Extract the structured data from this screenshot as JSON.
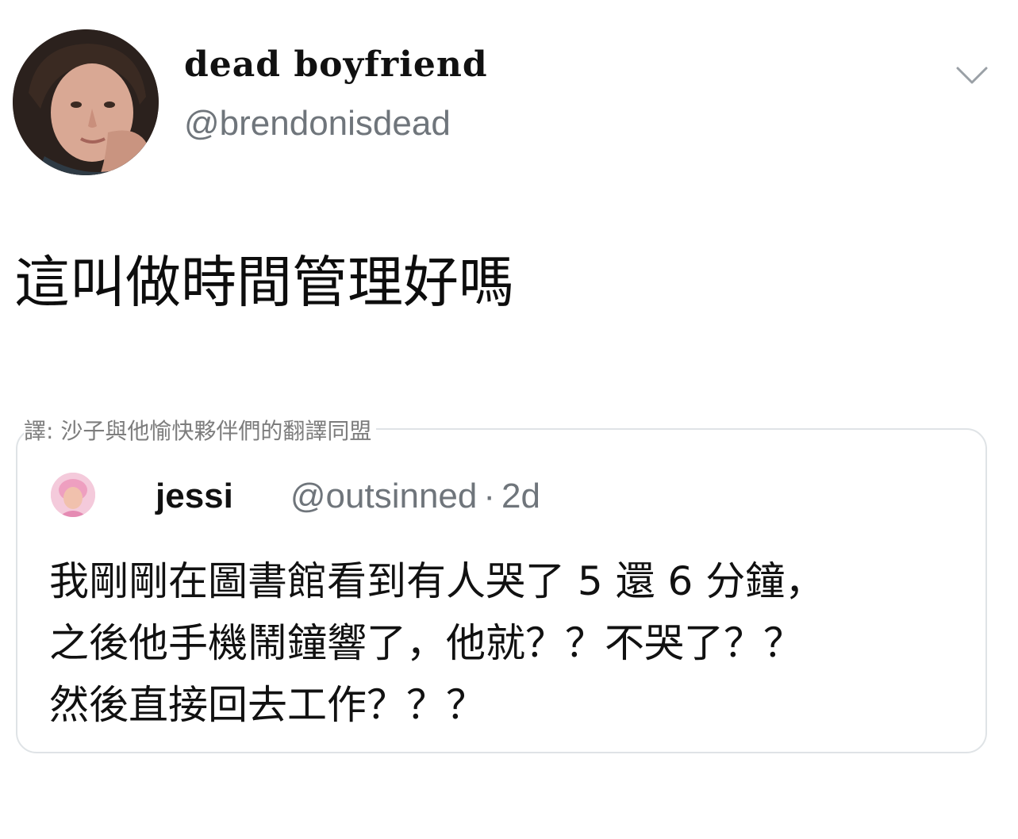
{
  "header": {
    "display_name": "dead boyfriend",
    "handle": "@brendonisdead",
    "avatar_icon": "profile-photo",
    "menu_icon": "chevron-down-icon"
  },
  "tweet": {
    "text": "這叫做時間管理好嗎"
  },
  "watermark": {
    "text": "譯: 沙子與他愉快夥伴們的翻譯同盟"
  },
  "quoted_tweet": {
    "display_name": "jessi",
    "name_icon": "crescent-moon-icon",
    "handle": "@outsinned",
    "separator": "·",
    "time": "2d",
    "lines": [
      "我剛剛在圖書館看到有人哭了 5 還 6 分鐘，",
      "之後他手機鬧鐘響了，他就？？不哭了？？",
      "然後直接回去工作？？？"
    ]
  },
  "colors": {
    "text_primary": "#111111",
    "text_secondary": "#6f757b",
    "card_border": "#dfe3e6",
    "background": "#ffffff"
  }
}
